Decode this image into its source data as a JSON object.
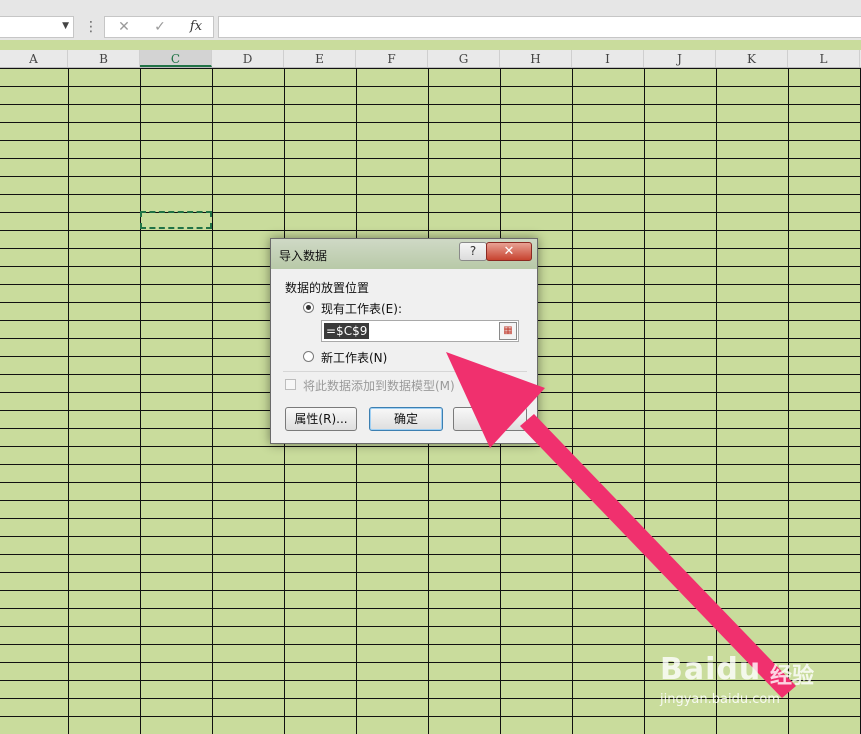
{
  "formula_bar": {
    "name_box_value": "",
    "cancel_glyph": "✕",
    "enter_glyph": "✓",
    "fx_label": "fx",
    "formula_value": ""
  },
  "columns": [
    "A",
    "B",
    "C",
    "D",
    "E",
    "F",
    "G",
    "H",
    "I",
    "J",
    "K",
    "L"
  ],
  "selected_column": "C",
  "dialog": {
    "title": "导入数据",
    "help": "?",
    "close": "✕",
    "group_label": "数据的放置位置",
    "option_existing": "现有工作表(E):",
    "reference_value": "=$C$9",
    "option_new": "新工作表(N)",
    "add_to_model": "将此数据添加到数据模型(M)",
    "btn_properties": "属性(R)...",
    "btn_ok": "确定",
    "btn_cancel": "取消"
  },
  "watermark": {
    "logo": "Baidu",
    "cn": "经验",
    "url": "jingyan.baidu.com"
  },
  "colors": {
    "sheet_fill": "#c9dc9c",
    "arrow": "#f0306e",
    "selection": "#217346"
  }
}
